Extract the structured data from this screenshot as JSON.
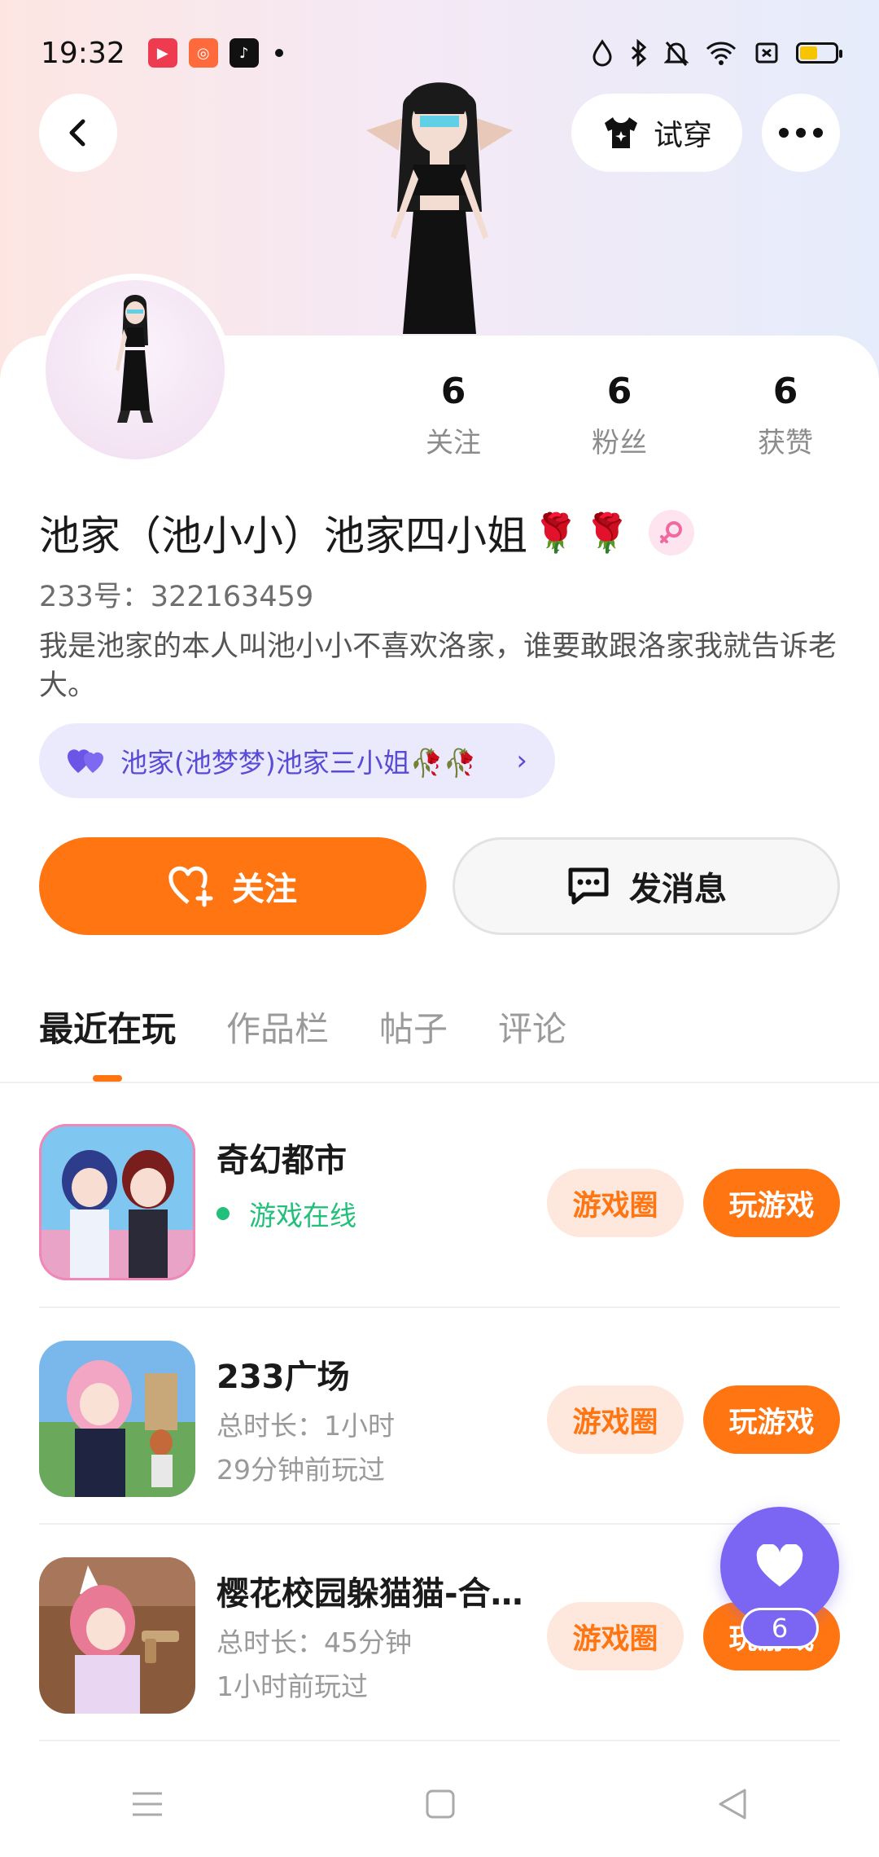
{
  "status_bar": {
    "time": "19:32",
    "apps": [
      "video-app-icon",
      "kuaishou-icon",
      "tiktok-icon"
    ],
    "battery_level": 0.5
  },
  "header": {
    "try_on_label": "试穿"
  },
  "profile": {
    "stats": [
      {
        "value": "6",
        "label": "关注"
      },
      {
        "value": "6",
        "label": "粉丝"
      },
      {
        "value": "6",
        "label": "获赞"
      }
    ],
    "name": "池家（池小小）池家四小姐",
    "name_emojis": [
      "🌹",
      "🌹"
    ],
    "uid": "233号：322163459",
    "bio": "我是池家的本人叫池小小不喜欢洛家，谁要敢跟洛家我就告诉老大。",
    "relation": "池家(池梦梦)池家三小姐🥀🥀",
    "follow_label": "关注",
    "message_label": "发消息"
  },
  "tabs": [
    {
      "label": "最近在玩",
      "active": true
    },
    {
      "label": "作品栏",
      "active": false
    },
    {
      "label": "帖子",
      "active": false
    },
    {
      "label": "评论",
      "active": false
    }
  ],
  "games": [
    {
      "title": "奇幻都市",
      "online_text": "游戏在线",
      "circle_label": "游戏圈",
      "play_label": "玩游戏"
    },
    {
      "title": "233广场",
      "duration": "总时长：1小时",
      "last_played": "29分钟前玩过",
      "circle_label": "游戏圈",
      "play_label": "玩游戏"
    },
    {
      "title": "樱花校园躲猫猫-合…",
      "duration": "总时长：45分钟",
      "last_played": "1小时前玩过",
      "circle_label": "游戏圈",
      "play_label": "玩游戏"
    }
  ],
  "like_fab": {
    "count": "6"
  },
  "colors": {
    "accent": "#ff7512",
    "accent_light": "#fee7dc",
    "purple": "#7b66f4",
    "online_green": "#22c07a"
  }
}
